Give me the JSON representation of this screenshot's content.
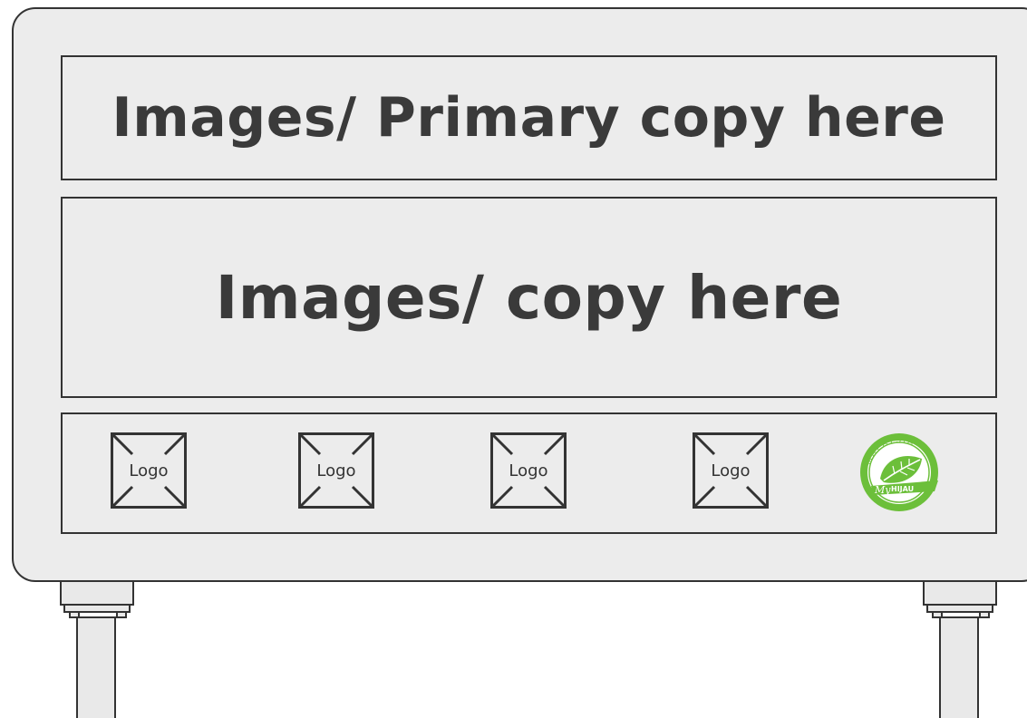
{
  "sign": {
    "primary_copy": "Images/ Primary copy here",
    "secondary_copy": "Images/ copy here",
    "logos": [
      {
        "label": "Logo"
      },
      {
        "label": "Logo"
      },
      {
        "label": "Logo"
      },
      {
        "label": "Logo"
      }
    ],
    "seal": {
      "arc_text": "MALAYSIA",
      "script_text": "My",
      "caps_text": "HIJAU",
      "icon": "leaf-icon",
      "color": "#6cbf3a"
    }
  },
  "colors": {
    "board_fill": "#ececec",
    "stroke": "#333333",
    "text": "#3a3a3a"
  }
}
